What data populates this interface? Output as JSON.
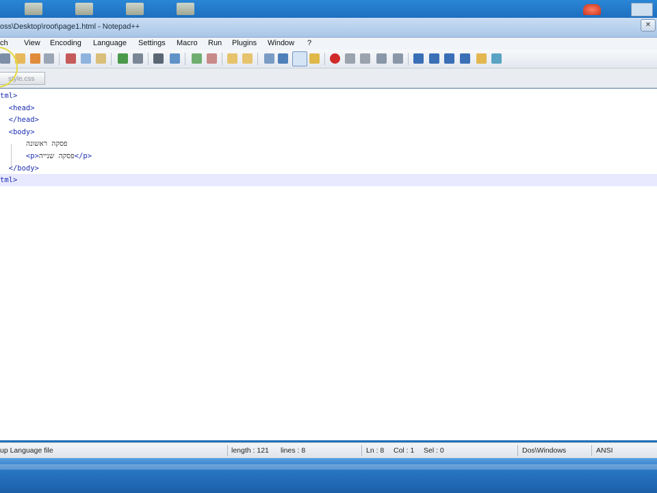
{
  "window": {
    "title": "oss\\Desktop\\root\\page1.html - Notepad++"
  },
  "menu": [
    "ch",
    "View",
    "Encoding",
    "Language",
    "Settings",
    "Macro",
    "Run",
    "Plugins",
    "Window",
    "?"
  ],
  "tab": {
    "label": "style.css"
  },
  "editor": {
    "lines": [
      {
        "parts": [
          {
            "t": "tag",
            "v": "tml>"
          }
        ]
      },
      {
        "parts": [
          {
            "t": "tag",
            "v": "  <head>"
          }
        ]
      },
      {
        "parts": [
          {
            "t": "tag",
            "v": "  </head>"
          }
        ]
      },
      {
        "parts": [
          {
            "t": "tag",
            "v": "  <body>"
          }
        ]
      },
      {
        "parts": [
          {
            "t": "txt",
            "v": "      פסקה ראשונה"
          }
        ]
      },
      {
        "parts": [
          {
            "t": "tag",
            "v": "      <p>"
          },
          {
            "t": "txt",
            "v": "פסקה שנייה"
          },
          {
            "t": "tag",
            "v": "</p>"
          }
        ]
      },
      {
        "parts": [
          {
            "t": "tag",
            "v": "  </body>"
          }
        ]
      },
      {
        "parts": [
          {
            "t": "tag",
            "v": "tml>"
          }
        ]
      }
    ],
    "current_line": 7
  },
  "status": {
    "file_type": "up Language file",
    "length": "length : 121",
    "lines": "lines : 8",
    "ln": "Ln : 8",
    "col": "Col : 1",
    "sel": "Sel : 0",
    "eol": "Dos\\Windows",
    "encoding": "ANSI"
  },
  "colors": {
    "tag": "#1c2fb0",
    "current_line_bg": "#e8e8ff",
    "highlight_circle": "#e6d83a"
  }
}
